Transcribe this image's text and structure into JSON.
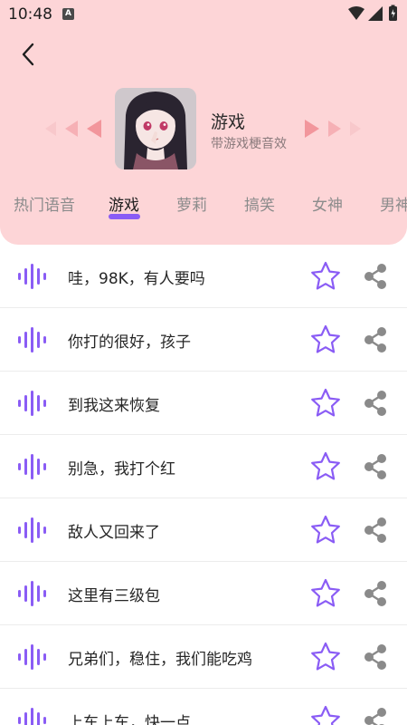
{
  "status_bar": {
    "time": "10:48",
    "badge": "A"
  },
  "category": {
    "title": "游戏",
    "subtitle": "带游戏梗音效"
  },
  "tabs": [
    {
      "label": "热门语音",
      "active": false
    },
    {
      "label": "游戏",
      "active": true
    },
    {
      "label": "萝莉",
      "active": false
    },
    {
      "label": "搞笑",
      "active": false
    },
    {
      "label": "女神",
      "active": false
    },
    {
      "label": "男神",
      "active": false
    }
  ],
  "sounds": [
    {
      "title": "哇，98K，有人要吗"
    },
    {
      "title": "你打的很好，孩子"
    },
    {
      "title": "到我这来恢复"
    },
    {
      "title": "别急，我打个红"
    },
    {
      "title": "敌人又回来了"
    },
    {
      "title": "这里有三级包"
    },
    {
      "title": "兄弟们，稳住，我们能吃鸡"
    },
    {
      "title": "上车上车，快一点"
    }
  ],
  "colors": {
    "header_bg": "#fdd5d7",
    "accent": "#8a5cf5",
    "icon_gray": "#8a8a8a"
  },
  "icons": [
    "back-arrow-icon",
    "sound-wave-icon",
    "star-icon",
    "share-icon",
    "wifi-icon",
    "signal-icon",
    "battery-icon"
  ]
}
